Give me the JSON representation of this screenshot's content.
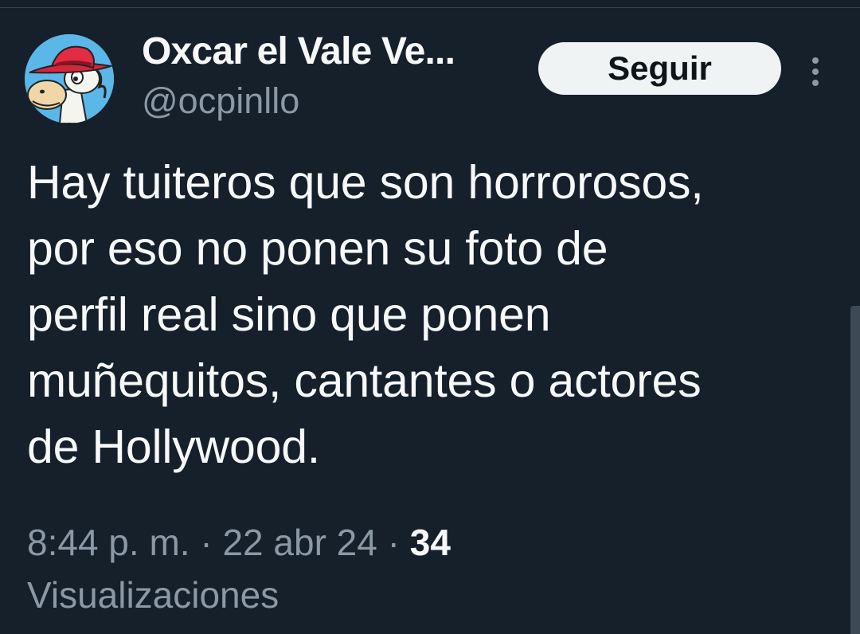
{
  "tweet": {
    "author": {
      "display_name": "Oxcar el Vale Ve...",
      "handle": "@ocpinllo",
      "avatar_icon": "cartoon-horse-with-red-hat-avatar"
    },
    "follow_label": "Seguir",
    "more_icon": "vertical-dots-icon",
    "text_lines": [
      "Hay tuiteros que son horrorosos,",
      "por eso no ponen su foto de",
      "perfil real sino que ponen",
      "muñequitos, cantantes o actores",
      "de Hollywood."
    ],
    "time": "8:44 p. m.",
    "separator": "·",
    "date": "22 abr 24",
    "views_count": "34",
    "views_label": "Visualizaciones"
  },
  "colors": {
    "background": "#15202b",
    "primary_text": "#f7f9f9",
    "secondary_text": "#8b98a5",
    "follow_button_bg": "#eff3f4",
    "follow_button_text": "#0f1419"
  }
}
